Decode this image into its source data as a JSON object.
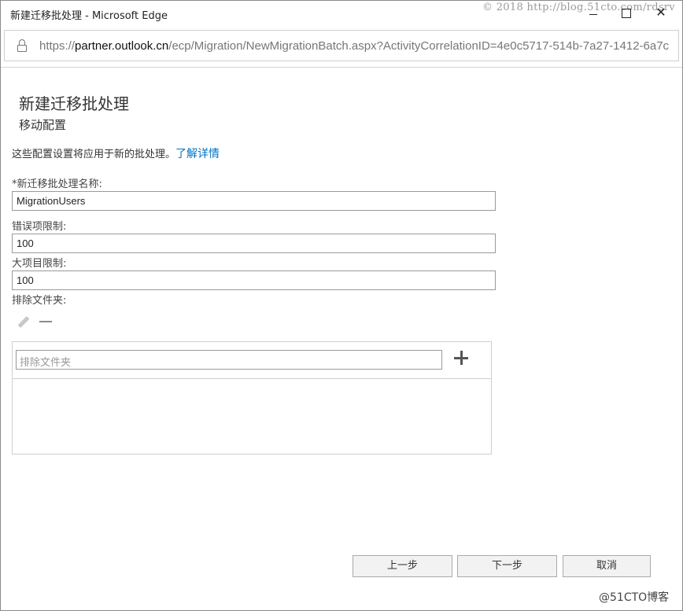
{
  "window": {
    "title": "新建迁移批处理 - Microsoft Edge",
    "watermark": "© 2018 http://blog.51cto.com/rdsrv",
    "close_glyph": "✕"
  },
  "address": {
    "scheme": "https://",
    "host": "partner.outlook.cn",
    "path": "/ecp/Migration/NewMigrationBatch.aspx?ActivityCorrelationID=4e0c5717-514b-7a27-1412-6a7c"
  },
  "page": {
    "title": "新建迁移批处理",
    "subtitle": "移动配置",
    "description": "这些配置设置将应用于新的批处理。",
    "learn_more": "了解详情"
  },
  "form": {
    "batch_name_label": "*新迁移批处理名称:",
    "batch_name_value": "MigrationUsers",
    "bad_item_limit_label": "错误项限制:",
    "bad_item_limit_value": "100",
    "large_item_limit_label": "大项目限制:",
    "large_item_limit_value": "100",
    "exclude_folders_label": "排除文件夹:",
    "exclude_folders_placeholder": "排除文件夹"
  },
  "buttons": {
    "prev": "上一步",
    "next": "下一步",
    "cancel": "取消"
  },
  "footer": {
    "watermark": "@51CTO博客"
  },
  "icons": [
    "lock-icon",
    "edit-pencil-icon",
    "remove-minus-icon",
    "add-plus-icon",
    "minimize-icon",
    "maximize-icon",
    "close-icon"
  ]
}
